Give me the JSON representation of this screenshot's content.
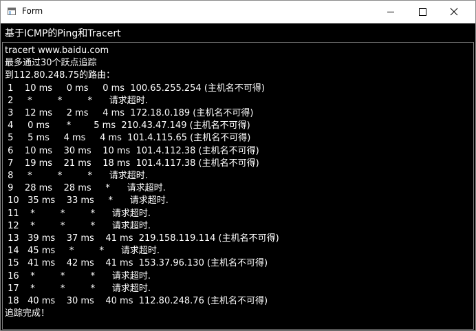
{
  "window": {
    "title": "Form",
    "icon": "app-window-icon",
    "controls": [
      "minimize-icon",
      "maximize-icon",
      "close-icon"
    ]
  },
  "header": {
    "label": "基于ICMP的Ping和Tracert"
  },
  "output": {
    "lines": [
      "tracert www.baidu.com",
      "最多通过30个跃点追踪",
      "到112.80.248.75的路由：",
      " 1    10 ms     0 ms     0 ms  100.65.255.254 (主机名不可得)",
      " 2     *         *         *      请求超时.",
      " 3    12 ms     2 ms     4 ms  172.18.0.189 (主机名不可得)",
      " 4     0 ms      *        5 ms  210.43.47.149 (主机名不可得)",
      " 5     5 ms     4 ms     4 ms  101.4.115.65 (主机名不可得)",
      " 6    10 ms    30 ms    10 ms  101.4.112.38 (主机名不可得)",
      " 7    19 ms    21 ms    18 ms  101.4.117.38 (主机名不可得)",
      " 8     *         *         *      请求超时.",
      " 9    28 ms    28 ms     *      请求超时.",
      " 10   35 ms    33 ms     *      请求超时.",
      " 11    *         *         *      请求超时.",
      " 12    *         *         *      请求超时.",
      " 13   39 ms    37 ms    41 ms  219.158.119.114 (主机名不可得)",
      " 14   45 ms     *         *      请求超时.",
      " 15   41 ms    42 ms    41 ms  153.37.96.130 (主机名不可得)",
      " 16    *         *         *      请求超时.",
      " 17    *         *         *      请求超时.",
      " 18   40 ms    30 ms    40 ms  112.80.248.76 (主机名不可得)",
      "追踪完成！"
    ]
  },
  "colors": {
    "background": "#000000",
    "text": "#ffffff",
    "titlebar": "#ffffff"
  }
}
